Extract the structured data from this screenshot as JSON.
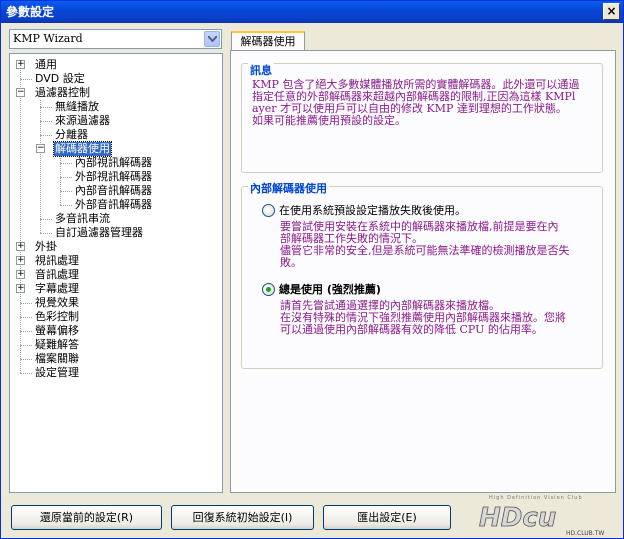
{
  "window": {
    "title": "參數設定",
    "close_label": "×"
  },
  "preset": {
    "selected": "KMP Wizard"
  },
  "tree": {
    "items": [
      {
        "label": "通用",
        "expander": "+"
      },
      {
        "label": "DVD 設定",
        "expander": ""
      },
      {
        "label": "過濾器控制",
        "expander": "−"
      },
      {
        "label": "無縫播放",
        "expander": ""
      },
      {
        "label": "來源過濾器",
        "expander": ""
      },
      {
        "label": "分離器",
        "expander": ""
      },
      {
        "label": "解碼器使用",
        "expander": "−"
      },
      {
        "label": "內部視訊解碼器",
        "expander": ""
      },
      {
        "label": "外部視訊解碼器",
        "expander": ""
      },
      {
        "label": "內部音訊解碼器",
        "expander": ""
      },
      {
        "label": "外部音訊解碼器",
        "expander": ""
      },
      {
        "label": "多音訊串流",
        "expander": ""
      },
      {
        "label": "自訂過濾器管理器",
        "expander": ""
      },
      {
        "label": "外掛",
        "expander": "+"
      },
      {
        "label": "視訊處理",
        "expander": "+"
      },
      {
        "label": "音訊處理",
        "expander": "+"
      },
      {
        "label": "字幕處理",
        "expander": "+"
      },
      {
        "label": "視覺效果",
        "expander": ""
      },
      {
        "label": "色彩控制",
        "expander": ""
      },
      {
        "label": "螢幕偏移",
        "expander": ""
      },
      {
        "label": "疑難解答",
        "expander": ""
      },
      {
        "label": "檔案關聯",
        "expander": ""
      },
      {
        "label": "設定管理",
        "expander": ""
      }
    ]
  },
  "tab": {
    "label": "解碼器使用"
  },
  "info": {
    "title": "訊息",
    "lines": [
      "KMP 包含了絕大多數媒體播放所需的實體解碼器。此外還可以通過",
      "指定任意的外部解碼器來超越內部解碼器的限制,正因為這樣 KMPl",
      "ayer 才可以使用戶可以自由的修改 KMP 達到理想的工作狀態。",
      "如果可能推薦使用預設的設定。"
    ]
  },
  "decoder": {
    "title": "內部解碼器使用",
    "option1": {
      "label": "在使用系統預設設定播放失敗後使用。",
      "desc": [
        "要嘗試使用安裝在系統中的解碼器來播放檔,前提是要在內",
        "部解碼器工作失敗的情況下。",
        "儘管它非常的安全,但是系統可能無法準確的檢測播放是否失",
        "敗。"
      ]
    },
    "option2": {
      "label": "總是使用 (強烈推薦)",
      "desc": [
        "請首先嘗試通過選擇的內部解碼器來播放檔。",
        "在沒有特殊的情況下強烈推薦使用內部解碼器來播放。您將",
        "可以通過使用內部解碼器有效的降低 CPU 的佔用率。"
      ]
    }
  },
  "buttons": {
    "reset": "還原當前的設定(R)",
    "defaults": "回復系統初始設定(I)",
    "export": "匯出設定(E)"
  },
  "watermark": {
    "brand": "HDcu",
    "tagline": "High Definition Vision Club",
    "url": "HD.CLUB.TW"
  },
  "colors": {
    "accent": "#0046d5",
    "info_text": "#8b1a8b",
    "selection": "#316ac5"
  }
}
